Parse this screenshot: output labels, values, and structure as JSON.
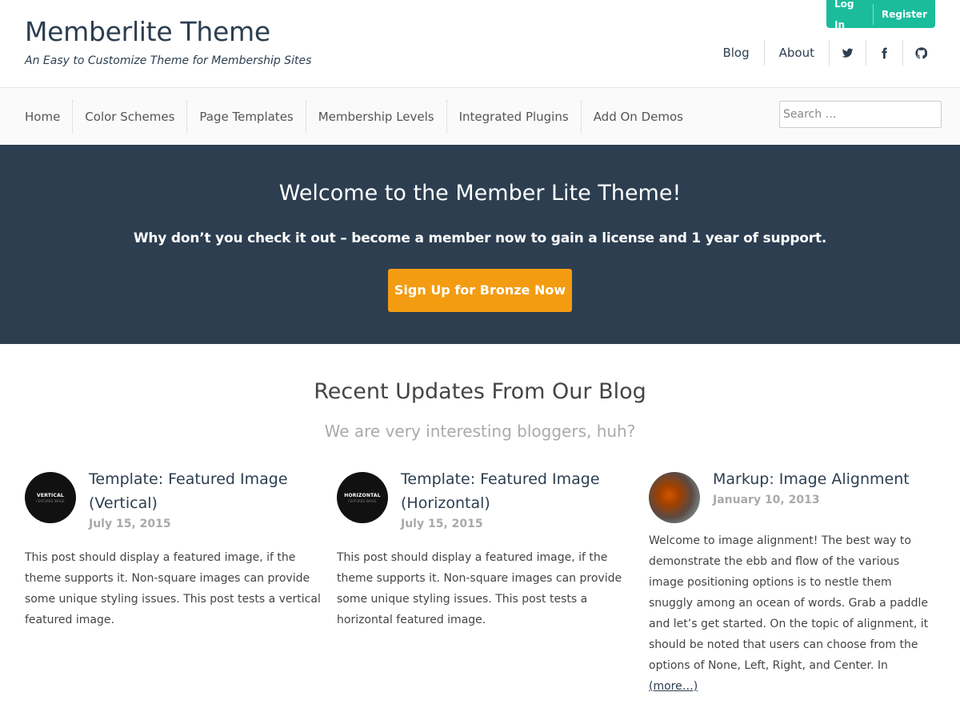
{
  "header": {
    "site_title": "Memberlite Theme",
    "tagline": "An Easy to Customize Theme for Membership Sites",
    "member_links": {
      "login": "Log In",
      "register": "Register"
    },
    "meta_nav": {
      "blog": "Blog",
      "about": "About"
    },
    "social_icons": [
      "twitter-icon",
      "facebook-icon",
      "github-icon"
    ]
  },
  "main_nav": {
    "items": [
      "Home",
      "Color Schemes",
      "Page Templates",
      "Membership Levels",
      "Integrated Plugins",
      "Add On Demos"
    ],
    "search_placeholder": "Search …"
  },
  "hero": {
    "heading": "Welcome to the Member Lite Theme!",
    "subtext": "Why don’t you check it out – become a member now to gain a license and 1 year of support.",
    "cta_label": "Sign Up for Bronze Now"
  },
  "blog": {
    "title": "Recent Updates From Our Blog",
    "subtitle": "We are very interesting bloggers, huh?",
    "posts": [
      {
        "title": "Template: Featured Image (Vertical)",
        "date": "July 15, 2015",
        "thumb_word": "VERTICAL",
        "thumb_sub": "FEATURED IMAGE",
        "excerpt": "This post should display a featured image, if the theme supports it. Non-square images can provide some unique styling issues. This post tests a vertical featured image."
      },
      {
        "title": "Template: Featured Image (Horizontal)",
        "date": "July 15, 2015",
        "thumb_word": "HORIZONTAL",
        "thumb_sub": "FEATURED IMAGE",
        "excerpt": "This post should display a featured image, if the theme supports it. Non-square images can provide some unique styling issues. This post tests a horizontal featured image."
      },
      {
        "title": "Markup: Image Alignment",
        "date": "January 10, 2013",
        "excerpt": "Welcome to image alignment! The best way to demonstrate the ebb and flow of the various image positioning options is to nestle them snuggly among an ocean of words. Grab a paddle and let’s get started. On the topic of alignment, it should be noted that users can choose from the options of None, Left, Right, and Center. In",
        "more_label": "(more…)"
      }
    ]
  },
  "colors": {
    "primary": "#2c3e50",
    "accent": "#1abc9c",
    "action": "#f39c12"
  }
}
